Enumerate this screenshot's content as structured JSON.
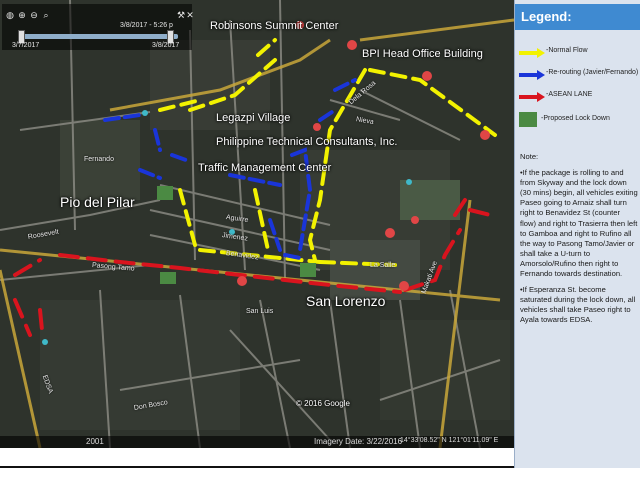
{
  "toolbar": {
    "time_start": "3/7/2017",
    "time_mid": "3/8/2017 - 5:26 p",
    "time_end": "3/8/2017",
    "icons": [
      "globe-icon",
      "zoom-in-icon",
      "zoom-out-icon",
      "search-icon",
      "wrench-icon",
      "close-icon"
    ]
  },
  "map": {
    "labels": {
      "robinsons": "Robinsons Summit Center",
      "bpi": "BPI Head Office Building",
      "legazpi": "Legazpi Village",
      "ptc": "Philippine Technical Consultants, Inc.",
      "tmc": "Traffic Management Center",
      "pio": "Pio del Pilar",
      "sanlorenzo": "San Lorenzo"
    },
    "streets": {
      "fernando": "Fernando",
      "roosevelt": "Roosevelt",
      "pasong_tamo": "Pasong Tamo",
      "aguirre": "Aguirre",
      "jimenez": "Jimenez",
      "benavidez": "Benavidez",
      "nieva": "Nieva",
      "la_salle": "La Salle",
      "dela_rosa": "Dela Rosa",
      "makati_ave": "Makati Ave",
      "don_bosco": "Don Bosco",
      "san_luis": "San Luis",
      "edsa": "EDSA"
    },
    "copyright": "© 2016 Google",
    "status": {
      "year": "2001",
      "imagery": "Imagery Date: 3/22/2016",
      "coords": "14°33'08.52\" N 121°01'11.09\" E"
    }
  },
  "legend": {
    "title": "Legend:",
    "items": [
      {
        "label": "-Normal Flow",
        "color": "#f2f200"
      },
      {
        "label": "-Re-routing (Javier/Fernando)",
        "color": "#1a35d9"
      },
      {
        "label": "-ASEAN LANE",
        "color": "#d9141e"
      },
      {
        "label": "-Proposed Lock Down",
        "color": "#4b8a43"
      }
    ],
    "note_heading": "Note:",
    "note_1": "•If the package is rolling to and from Skyway and the lock down (30 mins) begin, all vehicles exiting Paseo going to Arnaiz shall turn right to Benavidez St (counter flow) and right to Trasierra then left to Gamboa and right to Rufino all the way to Pasong Tamo/Javier or shall take a U-turn to Amorsolo/Rufino then right to Fernando towards destination.",
    "note_2": "•If Esperanza St. become saturated during the lock down, all vehicles shall take Paseo right to Ayala towards EDSA."
  }
}
